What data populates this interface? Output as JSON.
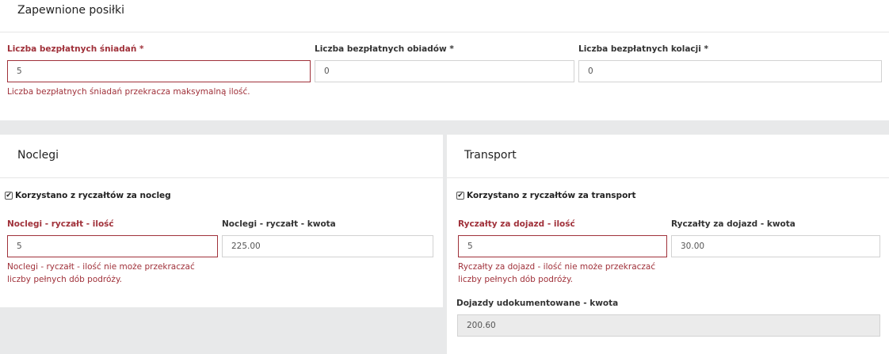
{
  "meals": {
    "title": "Zapewnione posiłki",
    "breakfast": {
      "label": "Liczba bezpłatnych śniadań *",
      "value": "5",
      "error": "Liczba bezpłatnych śniadań przekracza maksymalną ilość."
    },
    "lunch": {
      "label": "Liczba bezpłatnych obiadów *",
      "value": "0"
    },
    "dinner": {
      "label": "Liczba bezpłatnych kolacji *",
      "value": "0"
    }
  },
  "lodging": {
    "title": "Noclegi",
    "checkbox_label": "Korzystano z ryczałtów za nocleg",
    "checkbox_checked": true,
    "count": {
      "label": "Noclegi - ryczałt - ilość",
      "value": "5",
      "error": "Noclegi - ryczałt - ilość nie może przekraczać liczby pełnych dób podróży."
    },
    "amount": {
      "label": "Noclegi - ryczałt - kwota",
      "value": "225.00"
    }
  },
  "transport": {
    "title": "Transport",
    "checkbox_label": "Korzystano z ryczałtów za transport",
    "checkbox_checked": true,
    "count": {
      "label": "Ryczałty za dojazd - ilość",
      "value": "5",
      "error": "Ryczałty za dojazd - ilość nie może przekraczać liczby pełnych dób podróży."
    },
    "amount": {
      "label": "Ryczałty za dojazd - kwota",
      "value": "30.00"
    },
    "documented": {
      "label": "Dojazdy udokumentowane - kwota",
      "value": "200.60"
    }
  },
  "icons": {
    "checkmark": "✔"
  },
  "colors": {
    "error": "#a0313a",
    "background": "#e8e9ea",
    "panel": "#ffffff",
    "readonly_input": "#ebebeb"
  }
}
